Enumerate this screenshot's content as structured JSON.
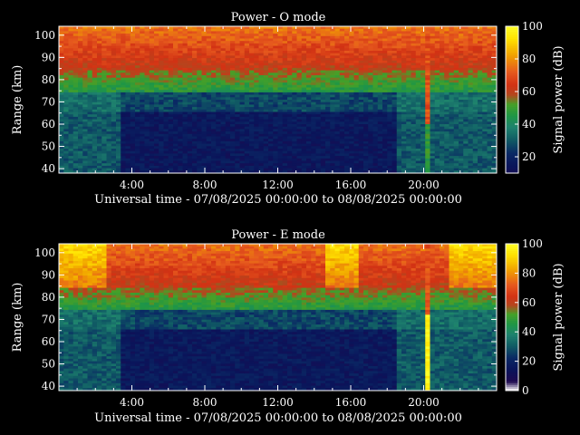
{
  "chart_data": [
    {
      "type": "heatmap",
      "title": "Power - O mode",
      "xlabel": "Universal time - 07/08/2025 00:00:00 to 08/08/2025 00:00:00",
      "ylabel": "Range (km)",
      "colorbar_label": "Signal power (dB)",
      "x_ticks": [
        "4:00",
        "8:00",
        "12:00",
        "16:00",
        "20:00"
      ],
      "x_tick_hours": [
        4,
        8,
        12,
        16,
        20
      ],
      "xlim_hours": [
        0,
        24
      ],
      "y_ticks": [
        40,
        50,
        60,
        70,
        80,
        90,
        100
      ],
      "ylim": [
        38,
        104
      ],
      "colorbar_ticks": [
        20,
        40,
        60,
        80,
        100
      ],
      "colorbar_range": [
        10,
        100
      ]
    },
    {
      "type": "heatmap",
      "title": "Power - E mode",
      "xlabel": "Universal time - 07/08/2025 00:00:00 to 08/08/2025 00:00:00",
      "ylabel": "Range (km)",
      "colorbar_label": "Signal power (dB)",
      "x_ticks": [
        "4:00",
        "8:00",
        "12:00",
        "16:00",
        "20:00"
      ],
      "x_tick_hours": [
        4,
        8,
        12,
        16,
        20
      ],
      "xlim_hours": [
        0,
        24
      ],
      "y_ticks": [
        40,
        50,
        60,
        70,
        80,
        90,
        100
      ],
      "ylim": [
        38,
        104
      ],
      "colorbar_ticks": [
        0,
        20,
        40,
        60,
        80,
        100
      ],
      "colorbar_range": [
        0,
        100
      ]
    }
  ],
  "colors": {
    "background": "#000000",
    "text": "#ffffff",
    "colormap": [
      "#ffffff",
      "#1a0a4a",
      "#0a1a5a",
      "#0d3a6a",
      "#106060",
      "#1f8a6a",
      "#22a040",
      "#4aa028",
      "#c04020",
      "#d84018",
      "#e86020",
      "#f0a000",
      "#ffe000",
      "#ffff20"
    ]
  }
}
